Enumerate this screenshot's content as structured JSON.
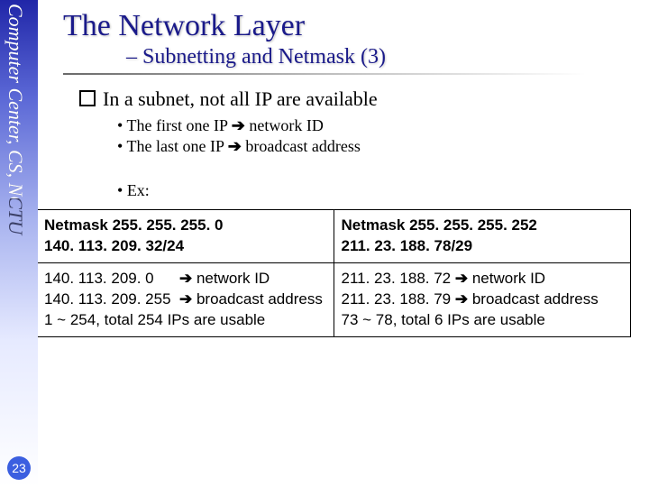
{
  "side_label": "Computer Center, CS, NCTU",
  "page_number": "23",
  "title": "The Network Layer",
  "subtitle": "– Subnetting and Netmask (3)",
  "main_bullet": "In a subnet, not all IP are available",
  "sub_bullets": [
    "The first one IP ➔ network ID",
    "The last one IP ➔ broadcast address"
  ],
  "ex_label": "Ex:",
  "table": {
    "rows": [
      [
        "Netmask 255. 255. 255. 0\n140. 113. 209. 32/24",
        "Netmask 255. 255. 255. 252\n211. 23. 188. 78/29"
      ],
      [
        "140. 113. 209. 0      ➔ network ID\n140. 113. 209. 255  ➔ broadcast address\n1 ~ 254, total 254 IPs are usable",
        "211. 23. 188. 72 ➔ network ID\n211. 23. 188. 79 ➔ broadcast address\n73 ~ 78, total 6 IPs are usable"
      ]
    ]
  }
}
